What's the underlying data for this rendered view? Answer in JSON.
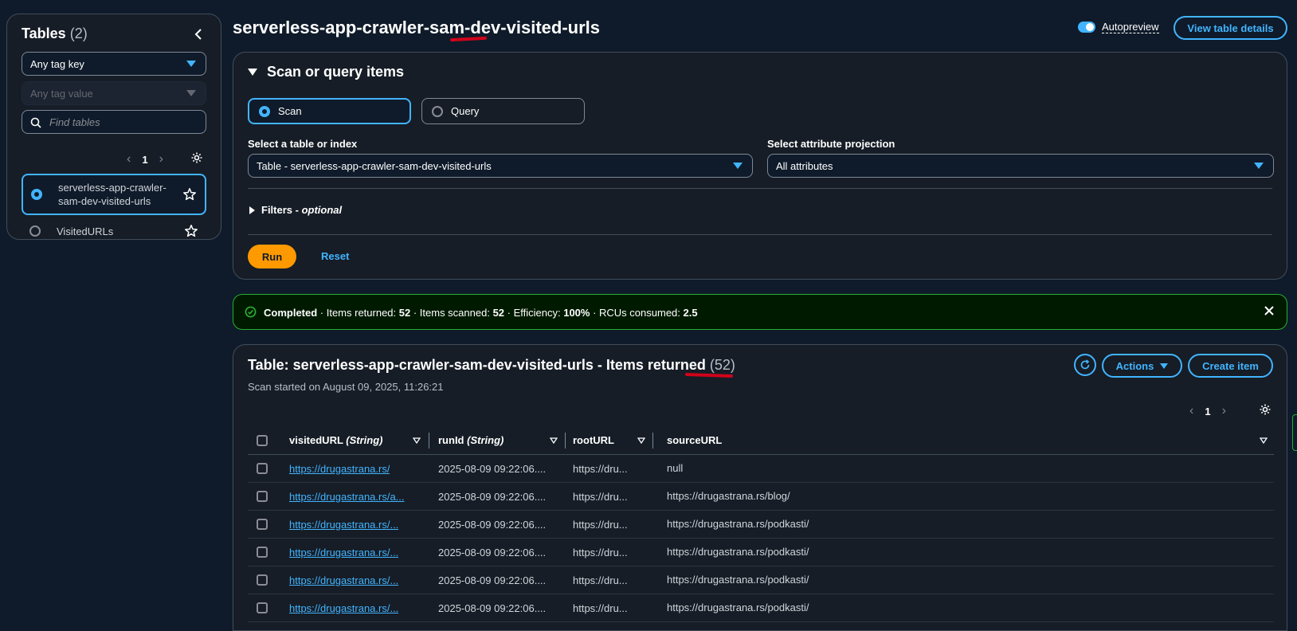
{
  "sidebar": {
    "title": "Tables",
    "count": "(2)",
    "tag_key": "Any tag key",
    "tag_value": "Any tag value",
    "find_placeholder": "Find tables",
    "page": "1",
    "tables": [
      {
        "name": "serverless-app-crawler-sam-dev-visited-urls",
        "selected": true
      },
      {
        "name": "VisitedURLs",
        "selected": false
      }
    ]
  },
  "header": {
    "title": "serverless-app-crawler-sam-dev-visited-urls",
    "autopreview_label": "Autopreview",
    "view_details_label": "View table details"
  },
  "scan_panel": {
    "title": "Scan or query items",
    "mode_scan": "Scan",
    "mode_query": "Query",
    "table_label": "Select a table or index",
    "table_value": "Table - serverless-app-crawler-sam-dev-visited-urls",
    "projection_label": "Select attribute projection",
    "projection_value": "All attributes",
    "filters_label": "Filters - ",
    "filters_optional": "optional",
    "run_label": "Run",
    "reset_label": "Reset"
  },
  "banner": {
    "status": "Completed",
    "items_returned_label": " · Items returned: ",
    "items_returned": "52",
    "items_scanned_label": " · Items scanned: ",
    "items_scanned": "52",
    "efficiency_label": " · Efficiency: ",
    "efficiency": "100%",
    "rcus_label": " · RCUs consumed: ",
    "rcus": "2.5"
  },
  "results": {
    "title": "Table: serverless-app-crawler-sam-dev-visited-urls - Items returned",
    "count": "(52)",
    "scan_started": "Scan started on August 09, 2025, 11:26:21",
    "actions_label": "Actions",
    "create_label": "Create item",
    "page": "1",
    "columns": [
      {
        "name": "visitedURL",
        "type": "(String)"
      },
      {
        "name": "runId",
        "type": "(String)"
      },
      {
        "name": "rootURL",
        "type": ""
      },
      {
        "name": "sourceURL",
        "type": ""
      }
    ],
    "rows": [
      {
        "visitedURL": "https://drugastrana.rs/",
        "runId": "2025-08-09 09:22:06....",
        "rootURL": "https://dru...",
        "sourceURL": "null"
      },
      {
        "visitedURL": "https://drugastrana.rs/a...",
        "runId": "2025-08-09 09:22:06....",
        "rootURL": "https://dru...",
        "sourceURL": "https://drugastrana.rs/blog/"
      },
      {
        "visitedURL": "https://drugastrana.rs/...",
        "runId": "2025-08-09 09:22:06....",
        "rootURL": "https://dru...",
        "sourceURL": "https://drugastrana.rs/podkasti/"
      },
      {
        "visitedURL": "https://drugastrana.rs/...",
        "runId": "2025-08-09 09:22:06....",
        "rootURL": "https://dru...",
        "sourceURL": "https://drugastrana.rs/podkasti/"
      },
      {
        "visitedURL": "https://drugastrana.rs/...",
        "runId": "2025-08-09 09:22:06....",
        "rootURL": "https://dru...",
        "sourceURL": "https://drugastrana.rs/podkasti/"
      },
      {
        "visitedURL": "https://drugastrana.rs/...",
        "runId": "2025-08-09 09:22:06....",
        "rootURL": "https://dru...",
        "sourceURL": "https://drugastrana.rs/podkasti/"
      }
    ]
  },
  "colors": {
    "background": "#0f1b2a",
    "panel": "#161d26",
    "accent": "#42b4ff",
    "run_button": "#ff9900",
    "success": "#29ad32",
    "annotation": "#d0021b"
  },
  "icons": [
    "chevron-left-icon",
    "caret-down-icon",
    "search-icon",
    "gear-icon",
    "star-icon",
    "check-circle-icon",
    "close-icon",
    "refresh-icon"
  ]
}
